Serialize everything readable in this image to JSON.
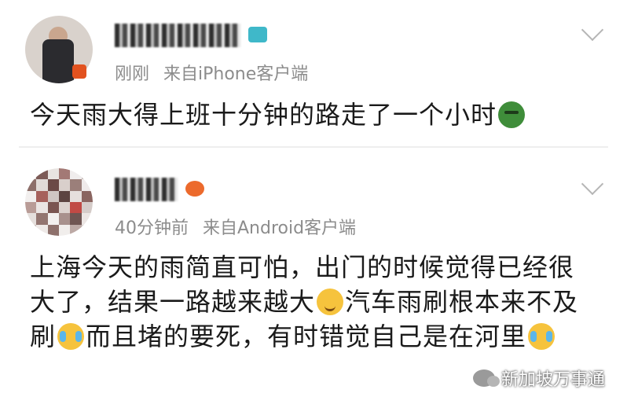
{
  "posts": [
    {
      "time": "刚刚",
      "source": "来自iPhone客户端",
      "text": "今天雨大得上班十分钟的路走了一个小时",
      "trailing_icon": "sick-face-emoji-icon"
    },
    {
      "time": "40分钟前",
      "source": "来自Android客户端",
      "text_part1": "上海今天的雨简直可怕，出门的时候觉得已经很大了，结果一路越来越大",
      "icon_a": "sweat-smile-emoji-icon",
      "text_part2": "汽车雨刷根本来不及刷",
      "icon_b": "crying-laughing-emoji-icon",
      "text_part3": "而且堵的要死，有时错觉自己是在河里",
      "icon_c": "crying-laughing-emoji-icon"
    }
  ],
  "watermark": {
    "text": "新加坡万事通",
    "icon": "wechat-icon"
  }
}
